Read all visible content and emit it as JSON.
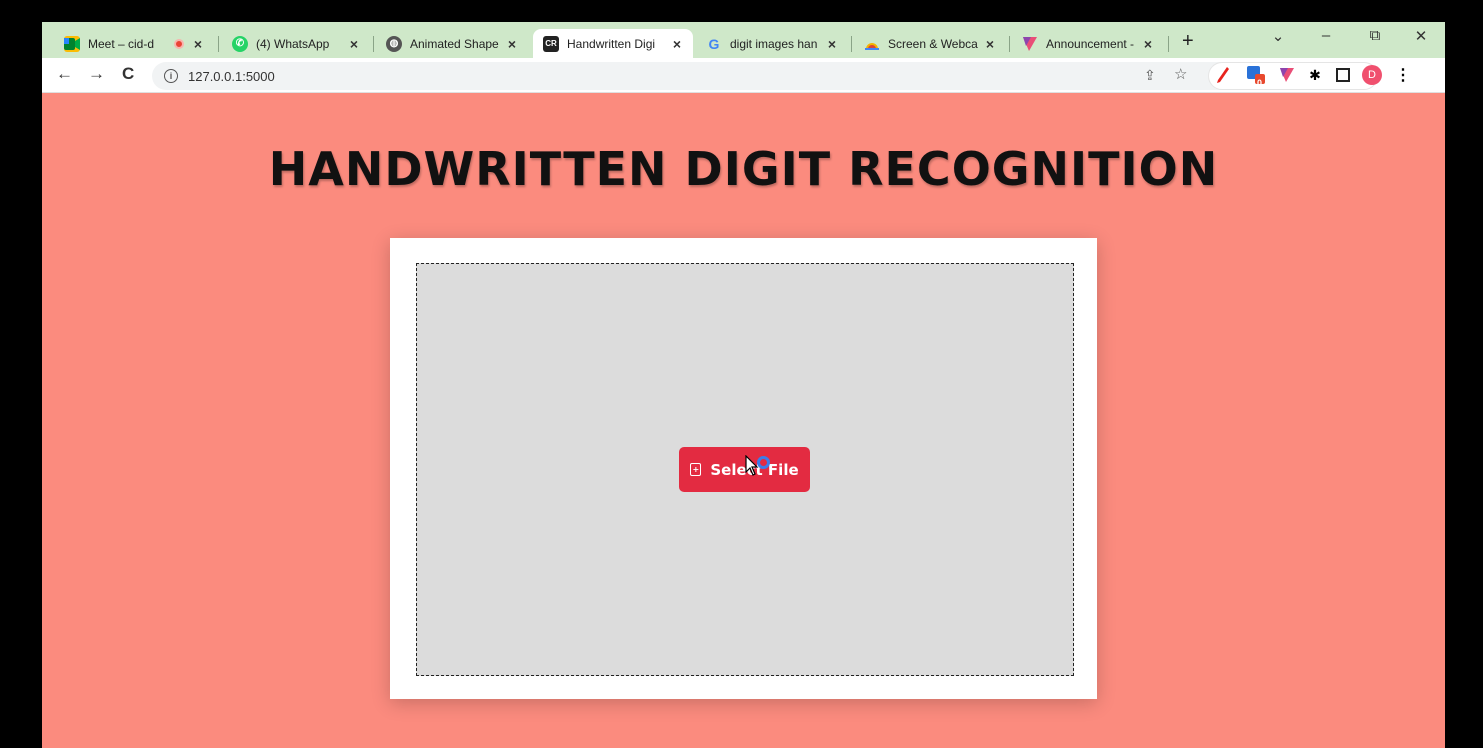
{
  "tabs": [
    {
      "label": "Meet – cid-d",
      "icon": "meet-icon",
      "recording": true
    },
    {
      "label": "(4) WhatsApp",
      "icon": "whatsapp-icon"
    },
    {
      "label": "Animated Shape",
      "icon": "globe-icon"
    },
    {
      "label": "Handwritten Digi",
      "icon": "cr-icon",
      "icon_text": "CR",
      "active": true
    },
    {
      "label": "digit images han",
      "icon": "google-icon",
      "icon_text": "G"
    },
    {
      "label": "Screen & Webca",
      "icon": "screen-recorder-icon"
    },
    {
      "label": "Announcement -",
      "icon": "flag-icon"
    }
  ],
  "tab_close_glyph": "×",
  "new_tab_glyph": "+",
  "window_controls": {
    "dropdown": "⌄",
    "minimize": "–",
    "restore": "⧉",
    "close": "✕"
  },
  "toolbar": {
    "back": "←",
    "forward": "→",
    "reload": "C",
    "info_glyph": "i",
    "url": "127.0.0.1:5000"
  },
  "extensions": {
    "badge_count": "0",
    "profile_initial": "D"
  },
  "page": {
    "title": "HANDWRITTEN DIGIT RECOGNITION",
    "select_button_label": "Select File"
  },
  "colors": {
    "page_background": "#fb8b7e",
    "button_red": "#e32b41",
    "tabstrip": "#cfe8c9",
    "dropzone": "#dcdcdc"
  }
}
